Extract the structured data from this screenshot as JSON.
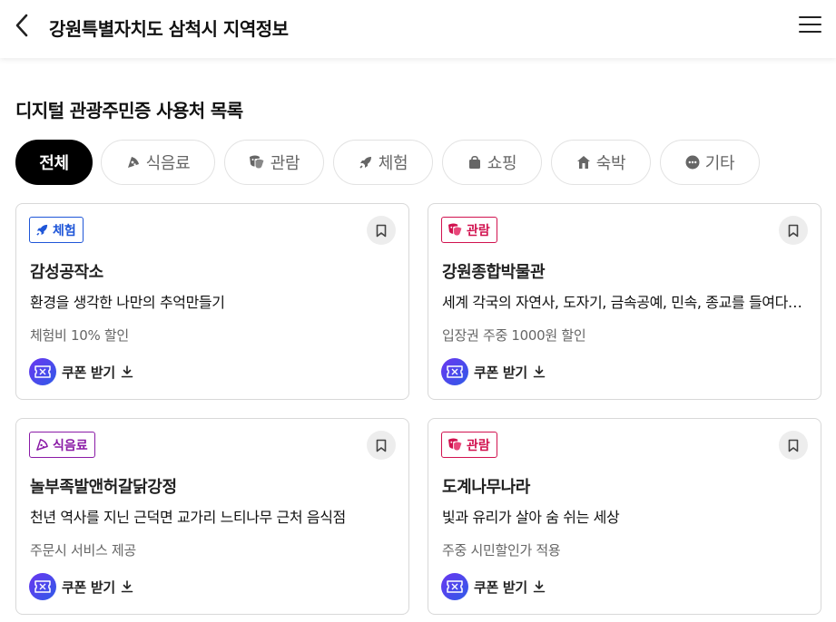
{
  "header": {
    "title": "강원특별자치도 삼척시 지역정보"
  },
  "section": {
    "title": "디지털 관광주민증 사용처 목록"
  },
  "chips": [
    {
      "label": "전체",
      "icon": "none",
      "active": true
    },
    {
      "label": "식음료",
      "icon": "pizza-icon",
      "active": false
    },
    {
      "label": "관람",
      "icon": "theater-mask-icon",
      "active": false
    },
    {
      "label": "체험",
      "icon": "rocket-icon",
      "active": false
    },
    {
      "label": "쇼핑",
      "icon": "shopping-bag-icon",
      "active": false
    },
    {
      "label": "숙박",
      "icon": "house-icon",
      "active": false
    },
    {
      "label": "기타",
      "icon": "more-dots-icon",
      "active": false
    }
  ],
  "cards": [
    {
      "badge": "체험",
      "badge_icon": "rocket-icon",
      "badge_color": "#1f56d8",
      "name": "감성공작소",
      "description": "환경을 생각한 나만의 추억만들기",
      "benefit": "체험비 10% 할인",
      "coupon_label": "쿠폰 받기"
    },
    {
      "badge": "관람",
      "badge_icon": "theater-mask-icon",
      "badge_color": "#d1124f",
      "name": "강원종합박물관",
      "description": "세계 각국의 자연사, 도자기, 금속공예, 민속, 종교를 들여다볼 수 있는 곳",
      "benefit": "입장권 주중 1000원 할인",
      "coupon_label": "쿠폰 받기"
    },
    {
      "badge": "식음료",
      "badge_icon": "pizza-icon",
      "badge_color": "#8a1aa6",
      "name": "놀부족발앤허갈닭강정",
      "description": "천년 역사를 지닌 근덕면 교가리 느티나무 근처 음식점",
      "benefit": "주문시 서비스 제공",
      "coupon_label": "쿠폰 받기"
    },
    {
      "badge": "관람",
      "badge_icon": "theater-mask-icon",
      "badge_color": "#d1124f",
      "name": "도계나무나라",
      "description": "빛과 유리가 살아 숨 쉬는 세상",
      "benefit": "주중 시민할인가 적용",
      "coupon_label": "쿠폰 받기"
    }
  ],
  "colors": {
    "active_chip_bg": "#000000",
    "coupon_gradient_start": "#6a36f0",
    "coupon_gradient_end": "#2f5be8"
  }
}
